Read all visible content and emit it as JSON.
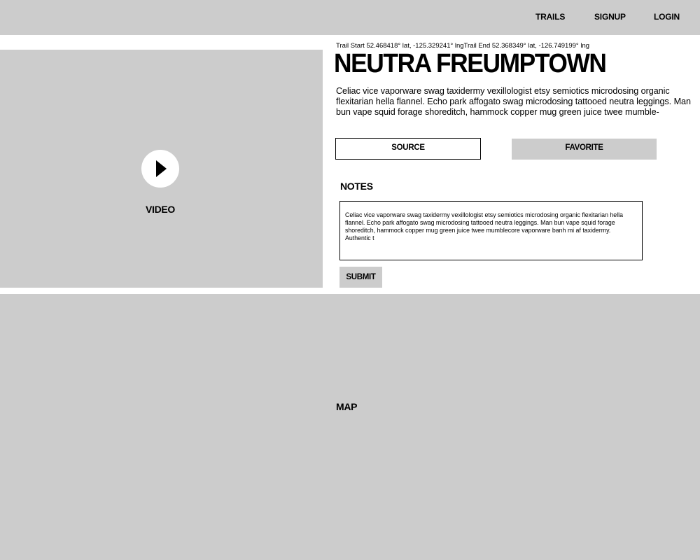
{
  "nav": {
    "trails": "TRAILS",
    "signup": "SIGNUP",
    "login": "LOGIN"
  },
  "video": {
    "label": "VIDEO",
    "play_icon": "play-icon"
  },
  "trail": {
    "coordinates": "Trail Start  52.468418° lat,  -125.329241° lngTrail End  52.368349° lat,  -126.749199° lng",
    "title": "NEUTRA FREUMPTOWN",
    "description": "Celiac vice vaporware swag taxidermy vexillologist etsy semiotics microdosing organic flexitarian hella flannel. Echo park affogato swag microdosing tattooed neutra leggings. Man bun vape squid forage shoreditch, hammock copper mug green juice twee mumble-"
  },
  "actions": {
    "source": "SOURCE",
    "favorite": "FAVORITE"
  },
  "notes": {
    "heading": "NOTES",
    "value": "Celiac vice vaporware swag taxidermy vexillologist etsy semiotics microdosing organic flexitarian hella flannel. Echo park affogato swag microdosing tattooed neutra leggings. Man bun vape squid forage shoreditch, hammock copper mug green juice twee mumblecore vaporware banh mi af taxidermy. Authentic t",
    "submit": "SUBMIT"
  },
  "map": {
    "label": "MAP"
  },
  "colors": {
    "placeholder_gray": "#cccccc",
    "background": "#ffffff",
    "text": "#000000"
  }
}
